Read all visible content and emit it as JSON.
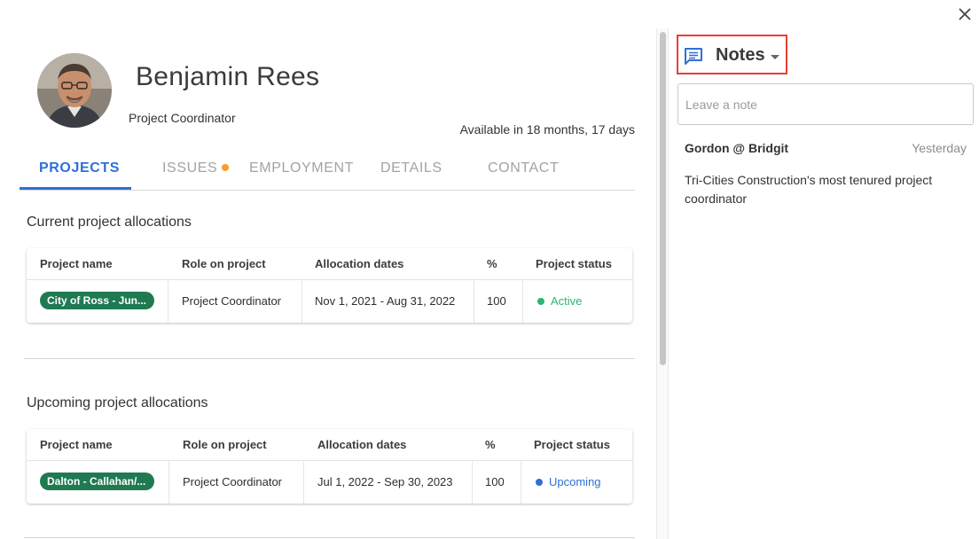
{
  "profile": {
    "name": "Benjamin Rees",
    "role": "Project Coordinator",
    "availability": "Available in 18 months, 17 days"
  },
  "tabs": [
    {
      "label": "PROJECTS",
      "active": true
    },
    {
      "label": "ISSUES",
      "has_indicator": true
    },
    {
      "label": "EMPLOYMENT"
    },
    {
      "label": "DETAILS"
    },
    {
      "label": "CONTACT"
    }
  ],
  "current": {
    "title": "Current project allocations",
    "headers": [
      "Project name",
      "Role on project",
      "Allocation dates",
      "%",
      "Project status"
    ],
    "rows": [
      {
        "project": "City of Ross - Jun...",
        "role": "Project Coordinator",
        "dates": "Nov 1, 2021 - Aug 31, 2022",
        "percent": "100",
        "status": "Active"
      }
    ]
  },
  "upcoming": {
    "title": "Upcoming project allocations",
    "headers": [
      "Project name",
      "Role on project",
      "Allocation dates",
      "%",
      "Project status"
    ],
    "rows": [
      {
        "project": "Dalton - Callahan/...",
        "role": "Project Coordinator",
        "dates": "Jul 1, 2022 - Sep 30, 2023",
        "percent": "100",
        "status": "Upcoming"
      }
    ]
  },
  "notes": {
    "title": "Notes",
    "placeholder": "Leave a note",
    "items": [
      {
        "author": "Gordon @ Bridgit",
        "date": "Yesterday",
        "text": "Tri-Cities Construction's most tenured project coordinator"
      }
    ]
  },
  "colors": {
    "accent": "#2f6fd8",
    "chip": "#1f7a52",
    "active": "#2bb673",
    "upcoming": "#2f6fd8",
    "issue_indicator": "#f59c2a",
    "highlight_border": "#e8402f"
  },
  "icons": {
    "close": "close-icon",
    "notes": "chat-bubble-icon",
    "dropdown": "caret-down-icon"
  }
}
